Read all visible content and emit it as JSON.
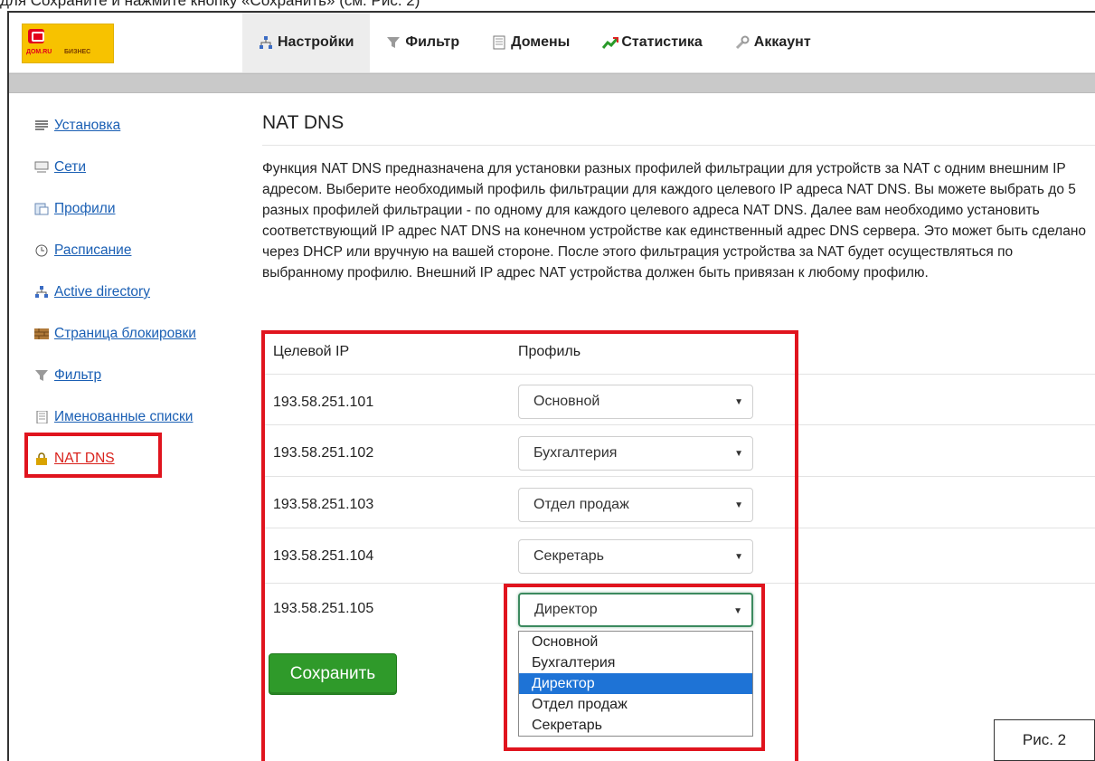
{
  "header": {
    "logo": {
      "text1": "ДОМ.RU",
      "text2": "БИЗНЕС"
    },
    "nav": [
      {
        "label": "Настройки",
        "icon": "network-icon",
        "active": true
      },
      {
        "label": "Фильтр",
        "icon": "filter-icon",
        "active": false
      },
      {
        "label": "Домены",
        "icon": "document-icon",
        "active": false
      },
      {
        "label": "Статистика",
        "icon": "chart-icon",
        "active": false
      },
      {
        "label": "Аккаунт",
        "icon": "wrench-icon",
        "active": false
      }
    ]
  },
  "sidebar": {
    "items": [
      {
        "label": "Установка",
        "icon": "list-icon"
      },
      {
        "label": "Сети",
        "icon": "network-numbers-icon"
      },
      {
        "label": "Профили",
        "icon": "profile-icon"
      },
      {
        "label": "Расписание",
        "icon": "clock-icon"
      },
      {
        "label": "Active directory",
        "icon": "directory-icon"
      },
      {
        "label": "Страница блокировки",
        "icon": "wall-icon"
      },
      {
        "label": "Фильтр",
        "icon": "filter-icon"
      },
      {
        "label": "Именованные списки",
        "icon": "notebook-icon"
      },
      {
        "label": "NAT DNS",
        "icon": "lock-icon",
        "active": true
      }
    ]
  },
  "main": {
    "title": "NAT DNS",
    "description": "Функция NAT DNS предназначена для установки разных профилей фильтрации для устройств за NAT с одним внешним IP адресом. Выберите необходимый профиль фильтрации для каждого целевого IP адреса NAT DNS. Вы можете выбрать до 5 разных профилей фильтрации - по одному для каждого целевого адреса NAT DNS. Далее вам необходимо установить соответствующий IP адрес NAT DNS на конечном устройстве как единственный адрес DNS сервера. Это может быть сделано через DHCP или вручную на вашей стороне. После этого фильтрация устройства за NAT будет осуществляться по выбранному профилю. Внешний IP адрес NAT устройства должен быть привязан к любому профилю.",
    "table": {
      "col_ip": "Целевой IP",
      "col_profile": "Профиль",
      "rows": [
        {
          "ip": "193.58.251.101",
          "profile": "Основной"
        },
        {
          "ip": "193.58.251.102",
          "profile": "Бухгалтерия"
        },
        {
          "ip": "193.58.251.103",
          "profile": "Отдел продаж"
        },
        {
          "ip": "193.58.251.104",
          "profile": "Секретарь"
        },
        {
          "ip": "193.58.251.105",
          "profile": "Директор"
        }
      ]
    },
    "dropdown_options": [
      "Основной",
      "Бухгалтерия",
      "Директор",
      "Отдел продаж",
      "Секретарь"
    ],
    "dropdown_selected": "Директор",
    "save_label": "Сохранить"
  },
  "figure_label": "Рис. 2",
  "top_cut_text": "для Сохраните и нажмите кнопку «Сохранить» (см. Рис. 2)",
  "colors": {
    "highlight": "#e0141e",
    "link": "#1a5fb4",
    "save": "#2f9a2a",
    "selected": "#1e73d6"
  }
}
